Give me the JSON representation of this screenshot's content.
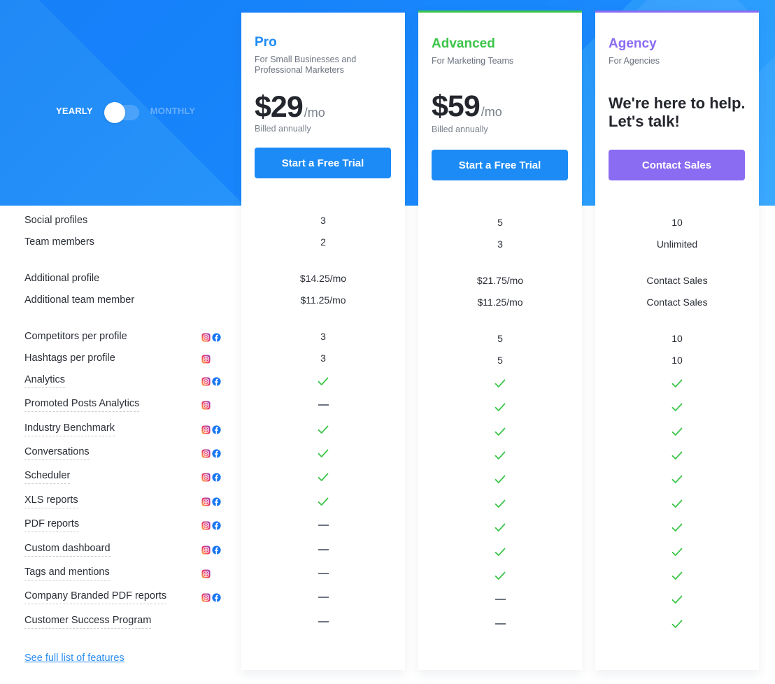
{
  "billing_toggle": {
    "yearly_label": "YEARLY",
    "monthly_label": "MONTHLY",
    "selected": "yearly"
  },
  "colors": {
    "brand_blue": "#1d8bf5",
    "advanced_green": "#3cc54a",
    "agency_purple": "#8a6cf2",
    "check_green": "#3cc54a"
  },
  "plans": [
    {
      "name": "Pro",
      "subtitle": "For Small Businesses and Professional Marketers",
      "price": "$29",
      "per": "/mo",
      "billing_note": "Billed annually",
      "cta_label": "Start a Free Trial",
      "accent": "#1d8bf5"
    },
    {
      "name": "Advanced",
      "subtitle": "For Marketing Teams",
      "price": "$59",
      "per": "/mo",
      "billing_note": "Billed annually",
      "cta_label": "Start a Free Trial",
      "accent": "#3cc54a"
    },
    {
      "name": "Agency",
      "subtitle": "For Agencies",
      "tagline": "We're here to help. Let's talk!",
      "cta_label": "Contact Sales",
      "accent": "#8a6cf2"
    }
  ],
  "features": [
    {
      "label": "Social profiles",
      "dotted": false,
      "platforms": [],
      "values": [
        "3",
        "5",
        "10"
      ]
    },
    {
      "label": "Team members",
      "dotted": false,
      "platforms": [],
      "values": [
        "2",
        "3",
        "Unlimited"
      ]
    },
    {
      "label": "Additional profile",
      "dotted": false,
      "platforms": [],
      "values": [
        "$14.25/mo",
        "$21.75/mo",
        "Contact Sales"
      ]
    },
    {
      "label": "Additional team member",
      "dotted": false,
      "platforms": [],
      "values": [
        "$11.25/mo",
        "$11.25/mo",
        "Contact Sales"
      ]
    },
    {
      "label": "Competitors per profile",
      "dotted": false,
      "platforms": [
        "instagram",
        "facebook"
      ],
      "values": [
        "3",
        "5",
        "10"
      ]
    },
    {
      "label": "Hashtags per profile",
      "dotted": false,
      "platforms": [
        "instagram"
      ],
      "values": [
        "3",
        "5",
        "10"
      ]
    },
    {
      "label": "Analytics",
      "dotted": true,
      "platforms": [
        "instagram",
        "facebook"
      ],
      "values": [
        "check",
        "check",
        "check"
      ]
    },
    {
      "label": "Promoted Posts Analytics",
      "dotted": true,
      "platforms": [
        "instagram"
      ],
      "values": [
        "dash",
        "check",
        "check"
      ]
    },
    {
      "label": "Industry Benchmark",
      "dotted": true,
      "platforms": [
        "instagram",
        "facebook"
      ],
      "values": [
        "check",
        "check",
        "check"
      ]
    },
    {
      "label": "Conversations",
      "dotted": true,
      "platforms": [
        "instagram",
        "facebook"
      ],
      "values": [
        "check",
        "check",
        "check"
      ]
    },
    {
      "label": "Scheduler",
      "dotted": true,
      "platforms": [
        "instagram",
        "facebook"
      ],
      "values": [
        "check",
        "check",
        "check"
      ]
    },
    {
      "label": "XLS reports",
      "dotted": true,
      "platforms": [
        "instagram",
        "facebook"
      ],
      "values": [
        "check",
        "check",
        "check"
      ]
    },
    {
      "label": "PDF reports",
      "dotted": true,
      "platforms": [
        "instagram",
        "facebook"
      ],
      "values": [
        "dash",
        "check",
        "check"
      ]
    },
    {
      "label": "Custom dashboard",
      "dotted": true,
      "platforms": [
        "instagram",
        "facebook"
      ],
      "values": [
        "dash",
        "check",
        "check"
      ]
    },
    {
      "label": "Tags and mentions",
      "dotted": true,
      "platforms": [
        "instagram"
      ],
      "values": [
        "dash",
        "check",
        "check"
      ]
    },
    {
      "label": "Company Branded PDF reports",
      "dotted": true,
      "platforms": [
        "instagram",
        "facebook"
      ],
      "values": [
        "dash",
        "dash",
        "check"
      ]
    },
    {
      "label": "Customer Success Program",
      "dotted": true,
      "platforms": [],
      "values": [
        "dash",
        "dash",
        "check"
      ]
    }
  ],
  "footer_link": "See full list of features"
}
